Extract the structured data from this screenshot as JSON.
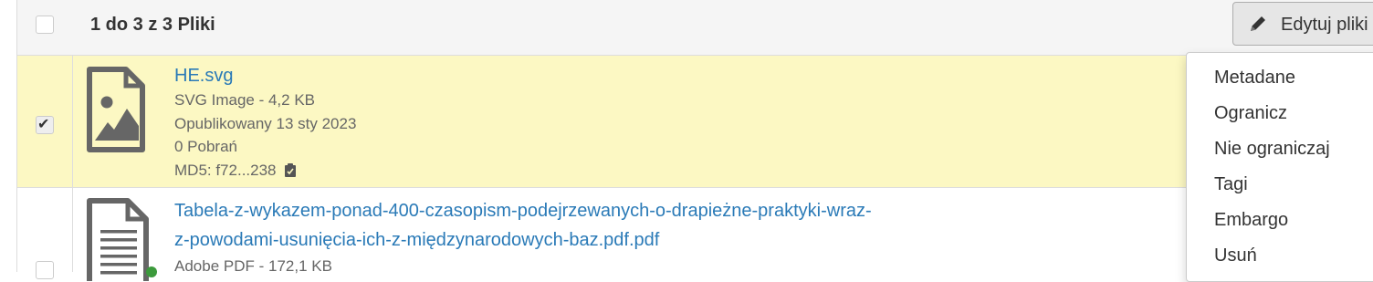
{
  "header": {
    "count_label": "1 do 3 z 3 Pliki",
    "edit_button_label": "Edytuj pliki"
  },
  "files": [
    {
      "name": "HE.svg",
      "type_size": "SVG Image - 4,2 KB",
      "published": "Opublikowany 13 sty 2023",
      "downloads": "0 Pobrań",
      "md5": "MD5: f72...238",
      "selected": true,
      "icon": "image-file-icon"
    },
    {
      "name_line1": "Tabela-z-wykazem-ponad-400-czasopism-podejrzewanych-o-drapieżne-praktyki-wraz-",
      "name_line2": "z-powodami-usunięcia-ich-z-międzynarodowych-baz.pdf.pdf",
      "type_size": "Adobe PDF - 172,1 KB",
      "selected": false,
      "icon": "document-file-icon"
    }
  ],
  "menu": {
    "items": [
      "Metadane",
      "Ogranicz",
      "Nie ograniczaj",
      "Tagi",
      "Embargo",
      "Usuń"
    ]
  },
  "colors": {
    "selected_row": "#fcf8c3",
    "link": "#2a7ab7",
    "header_bg": "#f5f5f5",
    "icon_gray": "#666666"
  }
}
